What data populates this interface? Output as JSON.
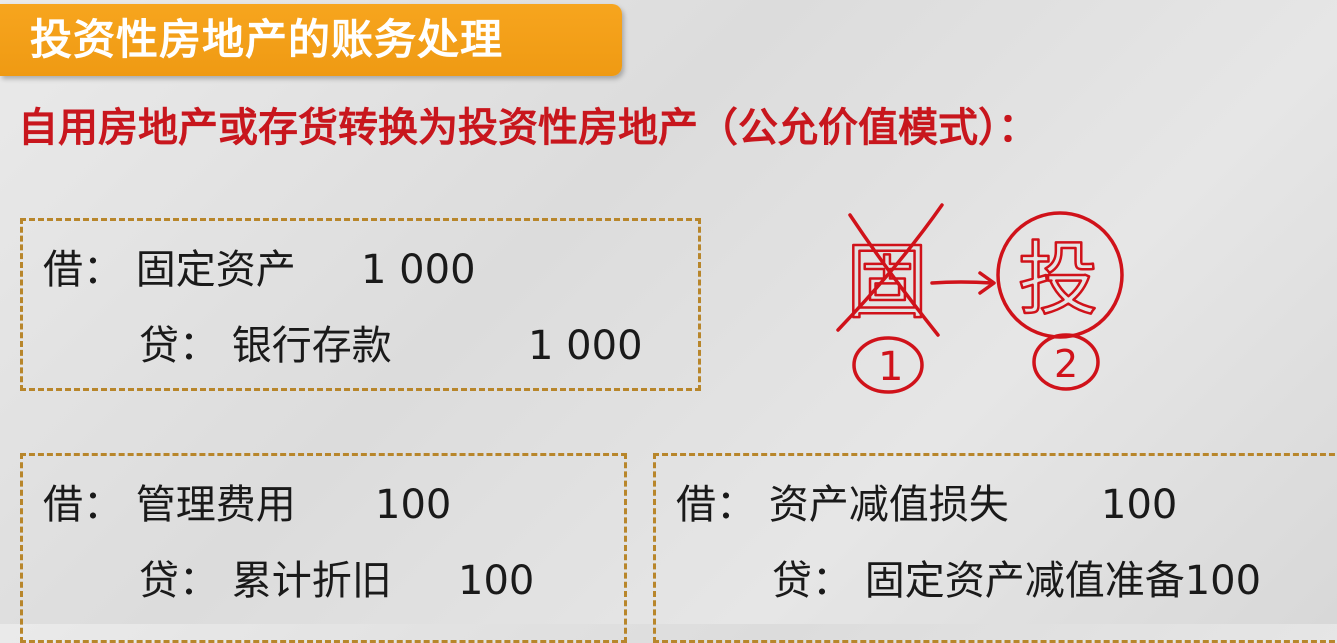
{
  "title": "投资性房地产的账务处理",
  "subtitle": "自用房地产或存货转换为投资性房地产（公允价值模式）：",
  "entries": [
    {
      "debit_label": "借：",
      "debit_account": "固定资产",
      "debit_amount": "1 000",
      "credit_label": "贷：",
      "credit_account": "银行存款",
      "credit_amount": "1 000"
    },
    {
      "debit_label": "借：",
      "debit_account": "管理费用",
      "debit_amount": "100",
      "credit_label": "贷：",
      "credit_account": "累计折旧",
      "credit_amount": "100"
    },
    {
      "debit_label": "借：",
      "debit_account": "资产减值损失",
      "debit_amount": "100",
      "credit_label": "贷：",
      "credit_account": "固定资产减值准备100",
      "credit_amount": ""
    }
  ],
  "annotation": {
    "from_char": "固",
    "from_num": "1",
    "to_char": "投",
    "to_num": "2",
    "ink_color": "#d0121a"
  }
}
